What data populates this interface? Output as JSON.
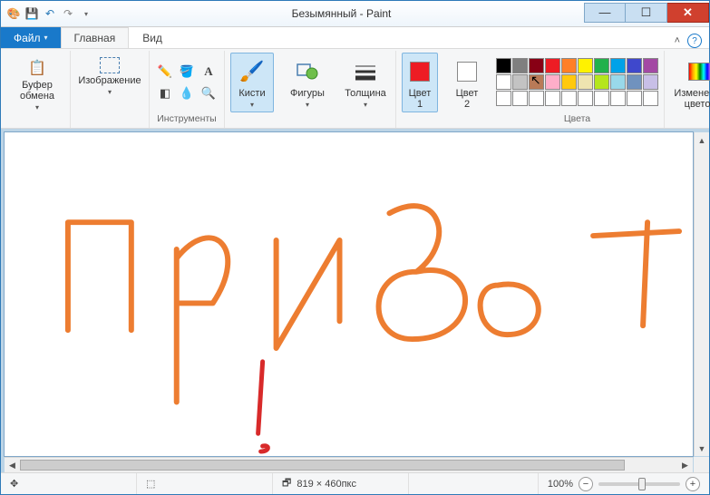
{
  "title": "Безымянный - Paint",
  "tabs": {
    "file": "Файл",
    "home": "Главная",
    "view": "Вид"
  },
  "groups": {
    "clipboard": {
      "btn": "Буфер\nобмена",
      "label": " "
    },
    "image": {
      "btn": "Изображение",
      "label": " "
    },
    "tools": {
      "label": "Инструменты"
    },
    "brushes": {
      "btn": "Кисти"
    },
    "shapes": {
      "btn": "Фигуры"
    },
    "thickness": {
      "btn": "Толщина"
    },
    "color1": {
      "btn": "Цвет\n1"
    },
    "color2": {
      "btn": "Цвет\n2"
    },
    "colors_label": "Цвета",
    "editcolors": {
      "btn": "Изменение\nцветов"
    }
  },
  "palette_row1": [
    "#000000",
    "#7f7f7f",
    "#880015",
    "#ed1c24",
    "#ff7f27",
    "#fff200",
    "#22b14c",
    "#00a2e8",
    "#3f48cc",
    "#a349a4"
  ],
  "palette_row2": [
    "#ffffff",
    "#c3c3c3",
    "#b97a57",
    "#ffaec9",
    "#ffc90e",
    "#efe4b0",
    "#b5e61d",
    "#99d9ea",
    "#7092be",
    "#c8bfe7"
  ],
  "palette_row3": [
    "#ffffff",
    "#ffffff",
    "#ffffff",
    "#ffffff",
    "#ffffff",
    "#ffffff",
    "#ffffff",
    "#ffffff",
    "#ffffff",
    "#ffffff"
  ],
  "color1_value": "#ed1c24",
  "color2_value": "#ffffff",
  "status": {
    "cursor_icon": "✥",
    "selection_icon": "⬚",
    "dims_icon": "🗗",
    "dimensions": "819 × 460пкс",
    "zoom": "100%"
  },
  "canvas_strokes": {
    "orange": [
      "M70 100 L70 220 M70 100 L140 100 L140 220",
      "M190 130 L190 300 M190 140 C230 90 270 130 230 190 L190 190",
      "M300 120 L300 240 M300 240 L370 120 M370 210 L370 120",
      "M425 90 C480 60 500 120 455 155 C525 140 530 230 450 230 C400 230 400 155 455 155",
      "M545 170 C600 160 605 225 555 225 C520 225 515 170 545 170",
      "M650 115 L745 110 M710 100 L705 215"
    ],
    "red": [
      "M285 255 L280 335",
      "M283 355 C293 355 293 347 285 349"
    ]
  }
}
